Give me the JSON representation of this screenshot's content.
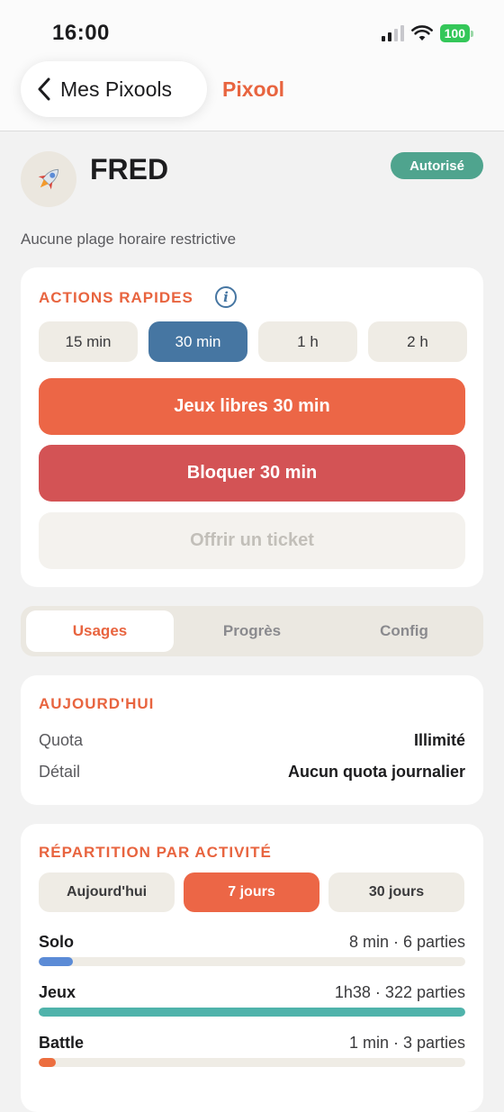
{
  "status_bar": {
    "time": "16:00",
    "battery": "100"
  },
  "nav": {
    "back_label": "Mes Pixools",
    "title": "Pixool"
  },
  "child": {
    "name": "FRED",
    "status_badge": "Autorisé",
    "schedule_note": "Aucune plage horaire restrictive"
  },
  "quick_actions": {
    "title": "ACTIONS RAPIDES",
    "durations": [
      "15 min",
      "30 min",
      "1 h",
      "2 h"
    ],
    "selected_duration": "30 min",
    "free_play_label": "Jeux libres 30 min",
    "block_label": "Bloquer 30 min",
    "ticket_label": "Offrir un ticket"
  },
  "tabs": {
    "items": [
      "Usages",
      "Progrès",
      "Config"
    ],
    "active": "Usages"
  },
  "today": {
    "title": "AUJOURD'HUI",
    "rows": [
      {
        "key": "Quota",
        "value": "Illimité"
      },
      {
        "key": "Détail",
        "value": "Aucun quota journalier"
      }
    ]
  },
  "breakdown": {
    "title": "RÉPARTITION PAR ACTIVITÉ",
    "periods": [
      "Aujourd'hui",
      "7 jours",
      "30 jours"
    ],
    "selected_period": "7 jours",
    "activities": [
      {
        "name": "Solo",
        "value": "8 min · 6 parties",
        "share": 0.08,
        "color": "#5b8bd6"
      },
      {
        "name": "Jeux",
        "value": "1h38 · 322 parties",
        "share": 1.0,
        "color": "#4fb3ab"
      },
      {
        "name": "Battle",
        "value": "1 min · 3 parties",
        "share": 0.04,
        "color": "#ec6e3f"
      }
    ]
  },
  "colors": {
    "accent": "#e8643f",
    "selected_blue": "#4676a2",
    "danger": "#d35355",
    "authorized": "#4fa48e"
  }
}
